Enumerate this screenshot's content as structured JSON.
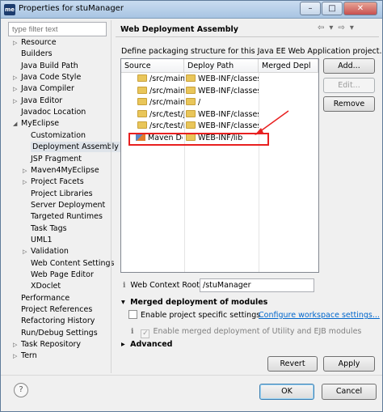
{
  "window": {
    "title": "Properties for stuManager",
    "app_icon": "me",
    "controls": {
      "minimize": "–",
      "maximize": "□",
      "close": "✕"
    }
  },
  "filter": {
    "placeholder": "type filter text"
  },
  "tree": [
    {
      "label": "Resource",
      "arrow": "▷"
    },
    {
      "label": "Builders",
      "arrow": ""
    },
    {
      "label": "Java Build Path",
      "arrow": ""
    },
    {
      "label": "Java Code Style",
      "arrow": "▷"
    },
    {
      "label": "Java Compiler",
      "arrow": "▷"
    },
    {
      "label": "Java Editor",
      "arrow": "▷"
    },
    {
      "label": "Javadoc Location",
      "arrow": ""
    },
    {
      "label": "MyEclipse",
      "arrow": "◢"
    },
    {
      "label": "Customization",
      "arrow": ""
    },
    {
      "label": "Deployment Assembly",
      "arrow": "",
      "selected": true
    },
    {
      "label": "JSP Fragment",
      "arrow": ""
    },
    {
      "label": "Maven4MyEclipse",
      "arrow": "▷"
    },
    {
      "label": "Project Facets",
      "arrow": "▷"
    },
    {
      "label": "Project Libraries",
      "arrow": ""
    },
    {
      "label": "Server Deployment",
      "arrow": ""
    },
    {
      "label": "Targeted Runtimes",
      "arrow": ""
    },
    {
      "label": "Task Tags",
      "arrow": ""
    },
    {
      "label": "UML1",
      "arrow": ""
    },
    {
      "label": "Validation",
      "arrow": "▷"
    },
    {
      "label": "Web Content Settings",
      "arrow": ""
    },
    {
      "label": "Web Page Editor",
      "arrow": ""
    },
    {
      "label": "XDoclet",
      "arrow": ""
    },
    {
      "label": "Performance",
      "arrow": ""
    },
    {
      "label": "Project References",
      "arrow": ""
    },
    {
      "label": "Refactoring History",
      "arrow": ""
    },
    {
      "label": "Run/Debug Settings",
      "arrow": ""
    },
    {
      "label": "Task Repository",
      "arrow": "▷"
    },
    {
      "label": "Tern",
      "arrow": "▷"
    }
  ],
  "page": {
    "title": "Web Deployment Assembly",
    "nav": {
      "back": "⇦",
      "back_menu": "▾",
      "forward": "⇨",
      "forward_menu": "▾"
    },
    "description": "Define packaging structure for this Java EE Web Application project."
  },
  "table": {
    "columns": [
      "Source",
      "Deploy Path",
      "Merged Depl"
    ],
    "rows": [
      {
        "source": "/src/main/",
        "deploy": "WEB-INF/classes",
        "merged": "",
        "icon": "folder"
      },
      {
        "source": "/src/main/",
        "deploy": "WEB-INF/classes",
        "merged": "",
        "icon": "folder"
      },
      {
        "source": "/src/main/",
        "deploy": "/",
        "merged": "",
        "icon": "folder"
      },
      {
        "source": "/src/test/ja",
        "deploy": "WEB-INF/classes",
        "merged": "",
        "icon": "folder"
      },
      {
        "source": "/src/test/r",
        "deploy": "WEB-INF/classes",
        "merged": "",
        "icon": "folder"
      },
      {
        "source": "Maven De",
        "deploy": "WEB-INF/lib",
        "merged": "",
        "icon": "maven"
      }
    ]
  },
  "buttons": {
    "add": "Add...",
    "edit": "Edit...",
    "remove": "Remove",
    "revert": "Revert",
    "apply": "Apply",
    "ok": "OK",
    "cancel": "Cancel",
    "help": "?"
  },
  "context_root": {
    "label": "Web Context Root:",
    "value": "/stuManager",
    "info": "i"
  },
  "merged_section": {
    "title": "Merged deployment of modules",
    "toggle": "▾",
    "project_specific": "Enable project specific settings",
    "configure_link": "Configure workspace settings...",
    "merged_utility": "Enable merged deployment of Utility and EJB modules",
    "info": "i",
    "check": "✓"
  },
  "advanced": {
    "title": "Advanced",
    "toggle": "▸"
  },
  "colors": {
    "annotation": "#e82020",
    "link": "#0066cc",
    "selection": "#cfe3f8"
  }
}
